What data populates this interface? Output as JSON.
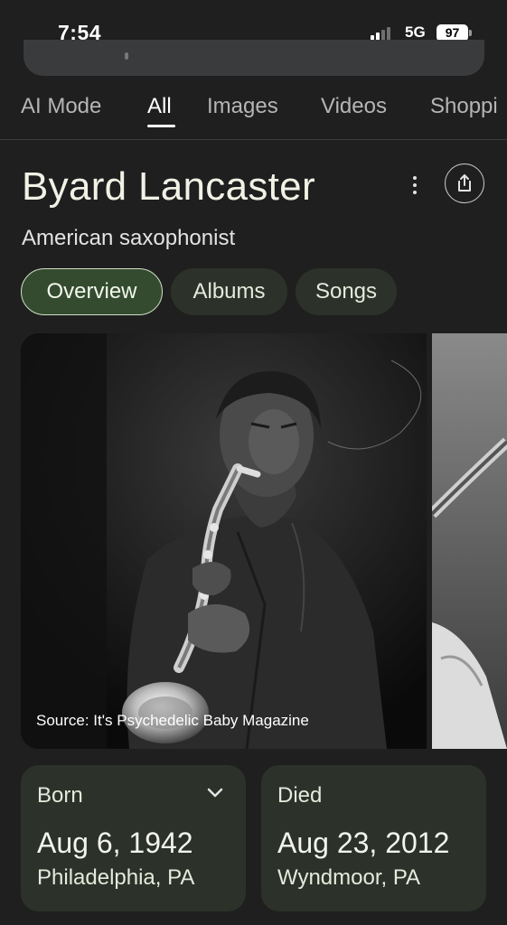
{
  "status": {
    "time": "7:54",
    "network": "5G",
    "battery": "97"
  },
  "tabs": [
    "AI Mode",
    "All",
    "Images",
    "Videos",
    "Shoppi"
  ],
  "entity": {
    "title": "Byard Lancaster",
    "subtitle": "American saxophonist",
    "chips": [
      "Overview",
      "Albums",
      "Songs"
    ]
  },
  "image": {
    "caption": "Source: It's Psychedelic Baby Magazine"
  },
  "facts": {
    "born": {
      "label": "Born",
      "date": "Aug 6, 1942",
      "place": "Philadelphia, PA"
    },
    "died": {
      "label": "Died",
      "date": "Aug 23, 2012",
      "place": "Wyndmoor, PA"
    }
  },
  "colors": {
    "background": "#1f1f1f",
    "chip_active": "#344b30",
    "card": "#2c3229",
    "title": "#f1f1e6"
  }
}
